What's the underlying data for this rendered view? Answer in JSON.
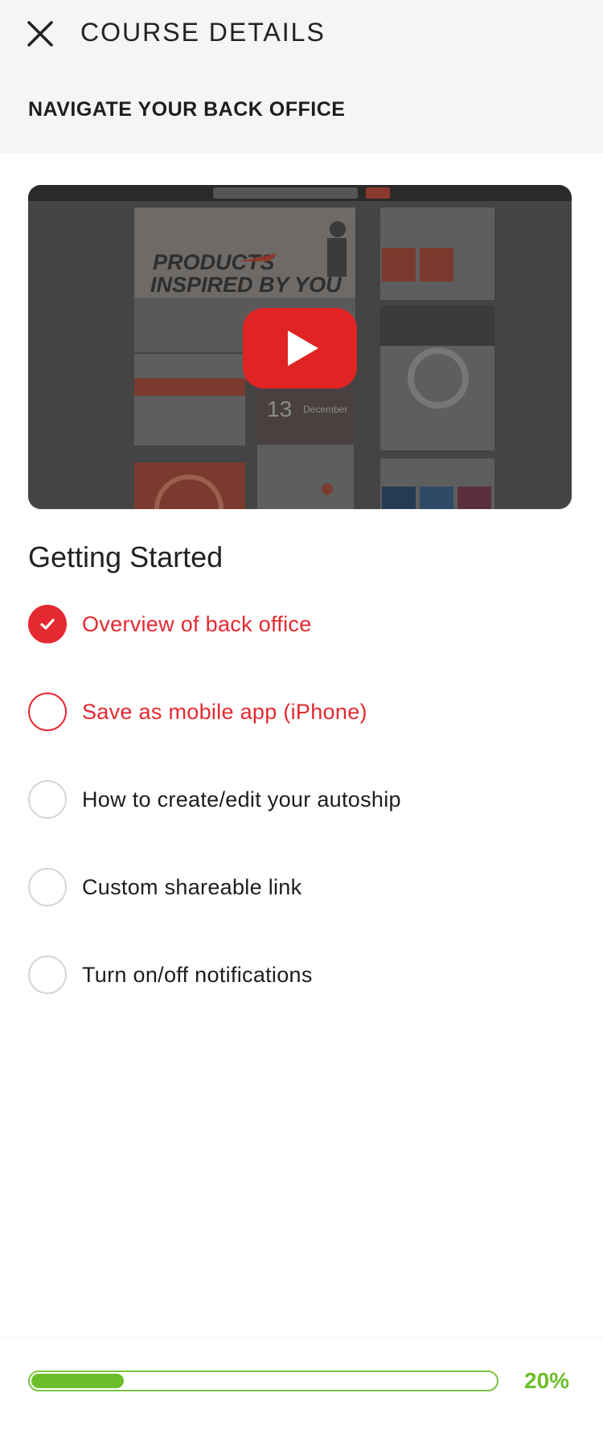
{
  "header": {
    "title": "COURSE DETAILS",
    "course_title": "NAVIGATE YOUR BACK OFFICE"
  },
  "video": {
    "headline_line1": "PRODUCTS",
    "headline_line2": "INSPIRED BY YOU",
    "date_number": "13",
    "date_label": "December"
  },
  "section": {
    "title": "Getting Started"
  },
  "lessons": [
    {
      "label": "Overview of back office",
      "state": "done"
    },
    {
      "label": "Save as mobile app (iPhone)",
      "state": "active"
    },
    {
      "label": "How to create/edit your autoship",
      "state": "pending"
    },
    {
      "label": "Custom shareable link",
      "state": "pending"
    },
    {
      "label": "Turn on/off notifications",
      "state": "pending"
    }
  ],
  "progress": {
    "value": 0.2,
    "label": "20%"
  },
  "colors": {
    "accent": "#e42930",
    "progress": "#6cbf2a",
    "header_bg": "#f5f5f5"
  },
  "icons": {
    "close": "close-icon",
    "play": "play-icon",
    "check": "checkmark-icon"
  }
}
